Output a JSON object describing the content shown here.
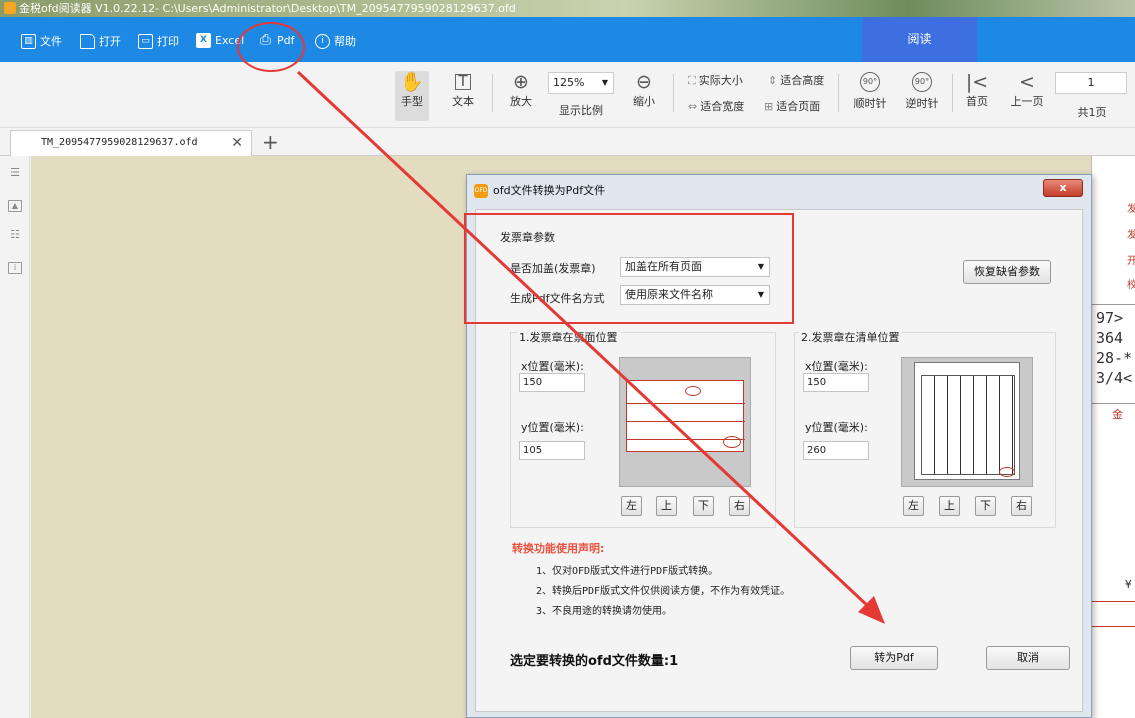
{
  "window": {
    "title": "金税ofd阅读器 V1.0.22.12- C:\\Users\\Administrator\\Desktop\\TM_2095477959028129637.ofd"
  },
  "menu": {
    "items": [
      {
        "label": "文件",
        "icon": "file-icon"
      },
      {
        "label": "打开",
        "icon": "folder-icon"
      },
      {
        "label": "打印",
        "icon": "printer-icon"
      },
      {
        "label": "Excel",
        "icon": "excel-icon"
      },
      {
        "label": "Pdf",
        "icon": "pdf-icon"
      },
      {
        "label": "帮助",
        "icon": "info-icon"
      }
    ],
    "read_tab": "阅读"
  },
  "toolbar": {
    "hand": "手型",
    "text": "文本",
    "zoom_in": "放大",
    "zoom_value": "125%",
    "zoom_ratio": "显示比例",
    "zoom_out": "缩小",
    "actual_size": "实际大小",
    "fit_height": "适合高度",
    "fit_width": "适合宽度",
    "fit_page": "适合页面",
    "rotate_cw": "顺时针",
    "rotate_ccw": "逆时针",
    "rotate_cw_glyph": "90°",
    "rotate_ccw_glyph": "90°",
    "first_page": "首页",
    "prev_page": "上一页",
    "page_number": "1",
    "total_pages": "共1页"
  },
  "tabs": {
    "doc_tab": "TM_2095477959028129637.ofd"
  },
  "document_preview": {
    "lines": [
      "97>",
      "364",
      "28-*",
      "3/4<"
    ],
    "red_chars": [
      "发",
      "发",
      "开",
      "校",
      "金",
      "¥"
    ]
  },
  "dialog": {
    "title": "ofd文件转换为Pdf文件",
    "icon_text": "OFD",
    "close": "x",
    "group_title": "发票章参数",
    "stamp_label": "是否加盖(发票章)",
    "stamp_value": "加盖在所有页面",
    "filename_label": "生成Pdf文件名方式",
    "filename_value": "使用原来文件名称",
    "restore_button": "恢复缺省参数",
    "panel1": {
      "title": "1.发票章在票面位置",
      "x_label": "x位置(毫米):",
      "x_value": "150",
      "y_label": "y位置(毫米):",
      "y_value": "105",
      "left": "左",
      "up": "上",
      "down": "下",
      "right": "右"
    },
    "panel2": {
      "title": "2.发票章在清单位置",
      "x_label": "x位置(毫米):",
      "x_value": "150",
      "y_label": "y位置(毫米):",
      "y_value": "260",
      "left": "左",
      "up": "上",
      "down": "下",
      "right": "右"
    },
    "notice_title": "转换功能使用声明:",
    "notice_lines": [
      "1、仅对OFD版式文件进行PDF版式转换。",
      "2、转换后PDF版式文件仅供阅读方便，不作为有效凭证。",
      "3、不良用途的转换请勿使用。"
    ],
    "count_text": "选定要转换的ofd文件数量:1",
    "convert_button": "转为Pdf",
    "cancel_button": "取消"
  },
  "colors": {
    "menubar": "#1e88e5",
    "annotation_red": "#e53935",
    "canvas": "#e4dcc0"
  }
}
